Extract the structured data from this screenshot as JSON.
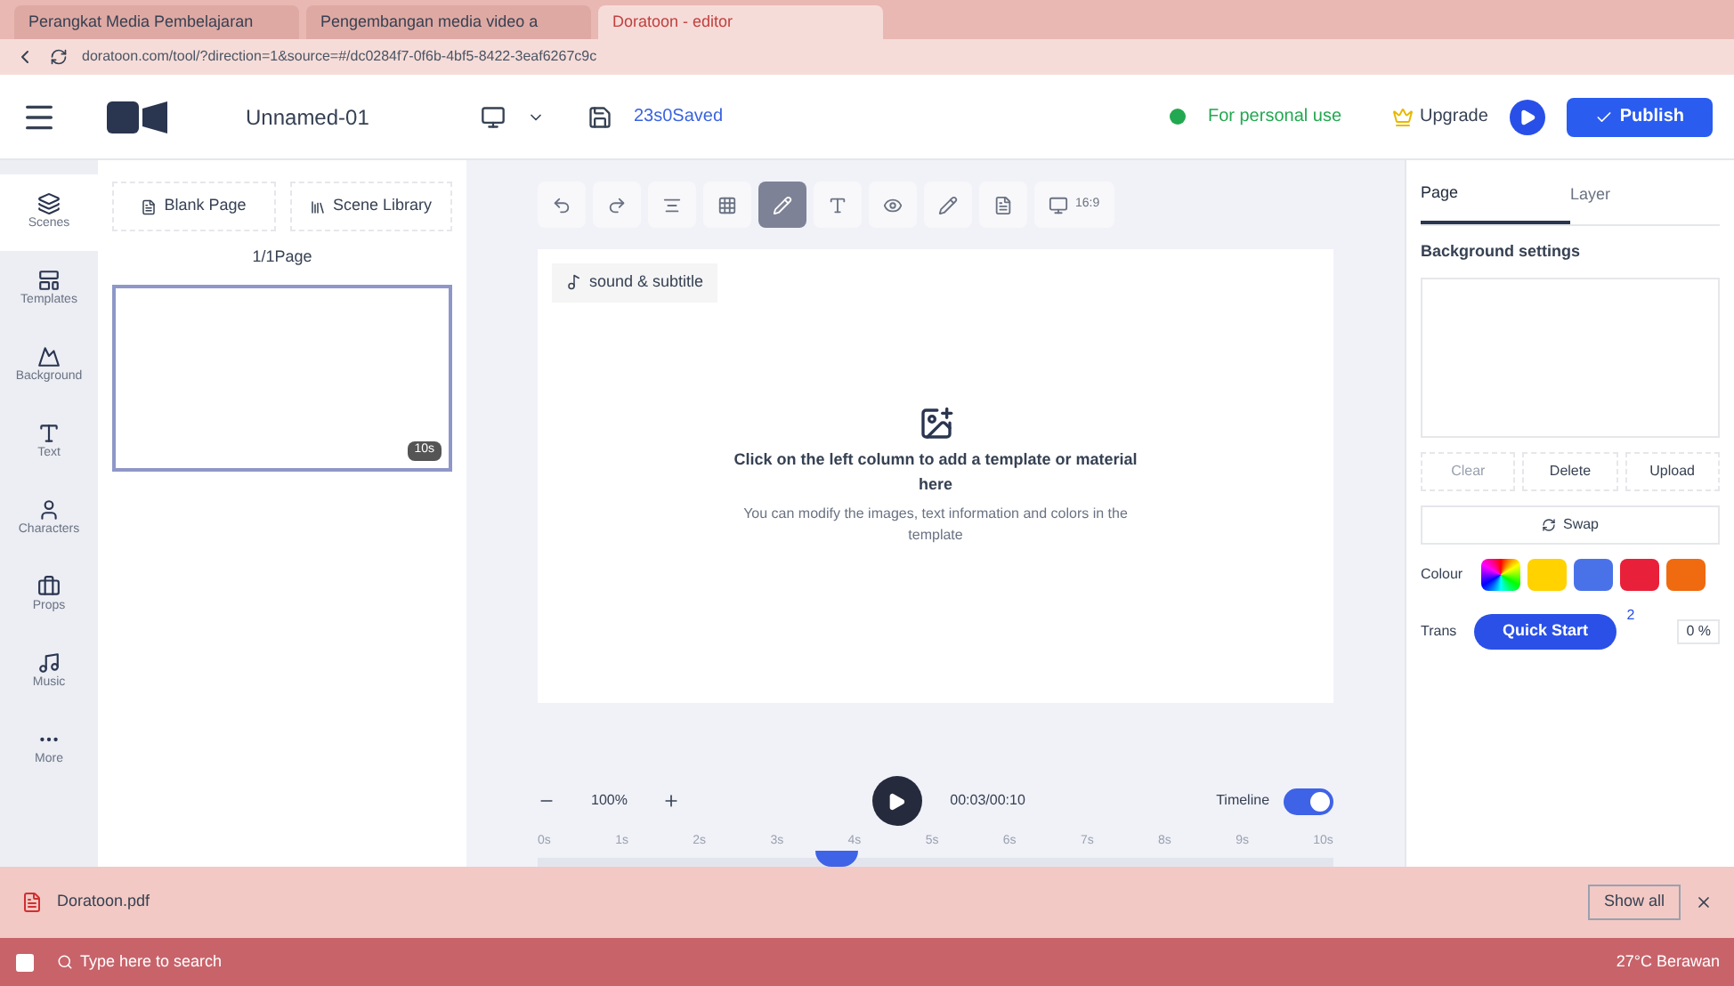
{
  "browser": {
    "tabs": [
      {
        "title": "Perangkat Media Pembelajaran",
        "selected": false
      },
      {
        "title": "Pengembangan media video a",
        "selected": false
      },
      {
        "title": "Doratoon - editor",
        "selected": true
      }
    ],
    "url": "doratoon.com/tool/?direction=1&source=#/dc0284f7-0f6b-4bf5-8422-3eaf6267c9c"
  },
  "header": {
    "project": "Unnamed-01",
    "save_status": "23s0Saved",
    "plan": "For personal use",
    "upgrade": "Upgrade",
    "publish": "Publish"
  },
  "rail": [
    {
      "label": "Scenes",
      "selected": true
    },
    {
      "label": "Templates",
      "selected": false
    },
    {
      "label": "Background",
      "selected": false
    },
    {
      "label": "Text",
      "selected": false
    },
    {
      "label": "Characters",
      "selected": false
    },
    {
      "label": "Props",
      "selected": false
    },
    {
      "label": "Music",
      "selected": false
    },
    {
      "label": "More",
      "selected": false
    }
  ],
  "scenes": {
    "buttons": [
      "Blank Page",
      "Scene Library"
    ],
    "page_count": "1/1Page",
    "thumb_badge": "10s"
  },
  "toolbar": [
    {
      "selected": false
    },
    {
      "selected": false
    },
    {
      "selected": false
    },
    {
      "selected": false
    },
    {
      "selected": true
    },
    {
      "selected": false
    },
    {
      "selected": false
    },
    {
      "selected": false
    },
    {
      "selected": false
    },
    {
      "selected": false,
      "label": "16:9"
    }
  ],
  "canvas": {
    "sound_button": "sound & subtitle",
    "hint_title": "Click on the left column to add a template or material here",
    "hint_body": "You can modify the images, text information and colors in the template"
  },
  "playback": {
    "zoom": "100%",
    "time": "00:03/00:10",
    "timeline_label": "Timeline",
    "timeline_on": true,
    "ticks": [
      "0s",
      "1s",
      "2s",
      "3s",
      "4s",
      "5s",
      "6s",
      "7s",
      "8s",
      "9s",
      "10s"
    ],
    "level": 0.35
  },
  "right": {
    "tabs": [
      {
        "label": "Page",
        "selected": true
      },
      {
        "label": "Layer",
        "selected": false
      }
    ],
    "heading": "Background settings",
    "actions": [
      "Clear",
      "Delete",
      "Upload"
    ],
    "swap": "Swap",
    "colour_label": "Colour",
    "swatches": [
      {
        "color": "#ffd200"
      },
      {
        "color": "#4a72e8"
      },
      {
        "color": "#e8203a"
      },
      {
        "color": "#f06a10"
      }
    ],
    "trans_label": "Trans",
    "trans_value": "0 %",
    "quick_start": "Quick Start",
    "quick_badge": "2"
  },
  "downloads": {
    "file": "Doratoon.pdf",
    "show_all": "Show all"
  },
  "taskbar": {
    "search": "Type here to search",
    "weather": "27°C Berawan"
  }
}
